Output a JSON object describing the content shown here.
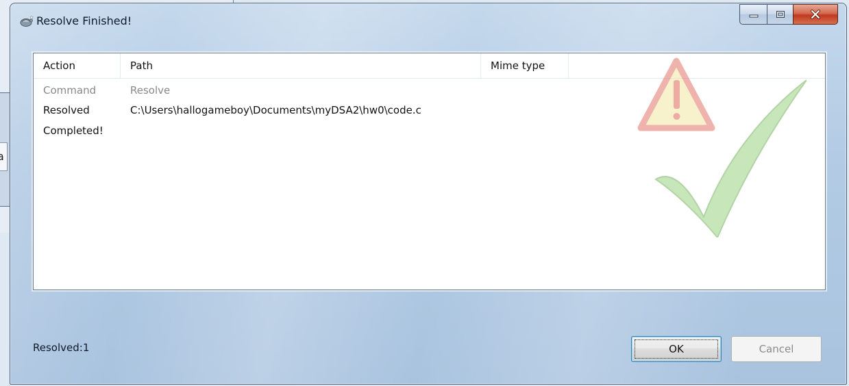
{
  "background": {
    "sliver_text": "a"
  },
  "window": {
    "title": "Resolve Finished!",
    "icon": "tortoise-icon"
  },
  "caption_buttons": [
    "minimize-icon",
    "maximize-icon",
    "close-icon"
  ],
  "table": {
    "columns": [
      "Action",
      "Path",
      "Mime type"
    ],
    "rows": [
      {
        "action": "Command",
        "path": "Resolve",
        "style": "grey"
      },
      {
        "action": "Resolved",
        "path": "C:\\Users\\hallogameboy\\Documents\\myDSA2\\hw0\\code.c",
        "style": "black"
      },
      {
        "action": "Completed!",
        "path": "",
        "style": "black"
      }
    ]
  },
  "watermark": [
    "warning-triangle-icon",
    "checkmark-icon"
  ],
  "status": "Resolved:1",
  "buttons": {
    "ok": "OK",
    "cancel": "Cancel"
  },
  "colors": {
    "warning": "#e56a5c",
    "check": "#7cc45a",
    "ok_border": "#3c7fb1"
  }
}
